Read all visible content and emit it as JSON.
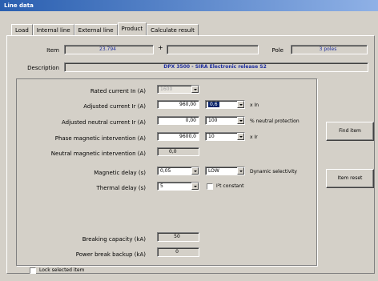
{
  "window": {
    "title": "Line data"
  },
  "tabs": [
    {
      "label": "Load"
    },
    {
      "label": "Internal line"
    },
    {
      "label": "External line"
    },
    {
      "label": "Product"
    },
    {
      "label": "Calculate result"
    }
  ],
  "header": {
    "item_label": "Item",
    "item_value": "23.794",
    "plus": "+",
    "pole_label": "Pole",
    "pole_value": "3 poles",
    "description_label": "Description",
    "description_value": "DPX 3500 - SIRA Electronic release S2"
  },
  "settings": {
    "rated_current": {
      "label": "Rated current In (A)",
      "value": "1600"
    },
    "adjusted_current": {
      "label": "Adjusted current Ir (A)",
      "value": "960,00",
      "factor": "0,6",
      "unit": "x In"
    },
    "adjusted_neutral": {
      "label": "Adjusted neutral current Ir (A)",
      "value": "0,00",
      "factor": "100",
      "unit": "% neutral protection"
    },
    "phase_magnetic": {
      "label": "Phase magnetic intervention (A)",
      "value": "9600,0",
      "factor": "10",
      "unit": "x Ir"
    },
    "neutral_magnetic": {
      "label": "Neutral magnetic intervention (A)",
      "value": "0,0"
    },
    "magnetic_delay": {
      "label": "Magnetic delay (s)",
      "value": "0,05",
      "mode": "LOW",
      "unit": "Dynamic selectivity"
    },
    "thermal_delay": {
      "label": "Thermal delay (s)",
      "value": "5",
      "checkbox_label": "I²t constant"
    },
    "breaking_capacity": {
      "label": "Breaking capacity (kA)",
      "value": "50"
    },
    "power_break_backup": {
      "label": "Power break backup (kA)",
      "value": "0"
    }
  },
  "buttons": {
    "find_item": "Find item",
    "item_reset": "Item reset"
  },
  "footer": {
    "lock_label": "Lock selected item"
  }
}
